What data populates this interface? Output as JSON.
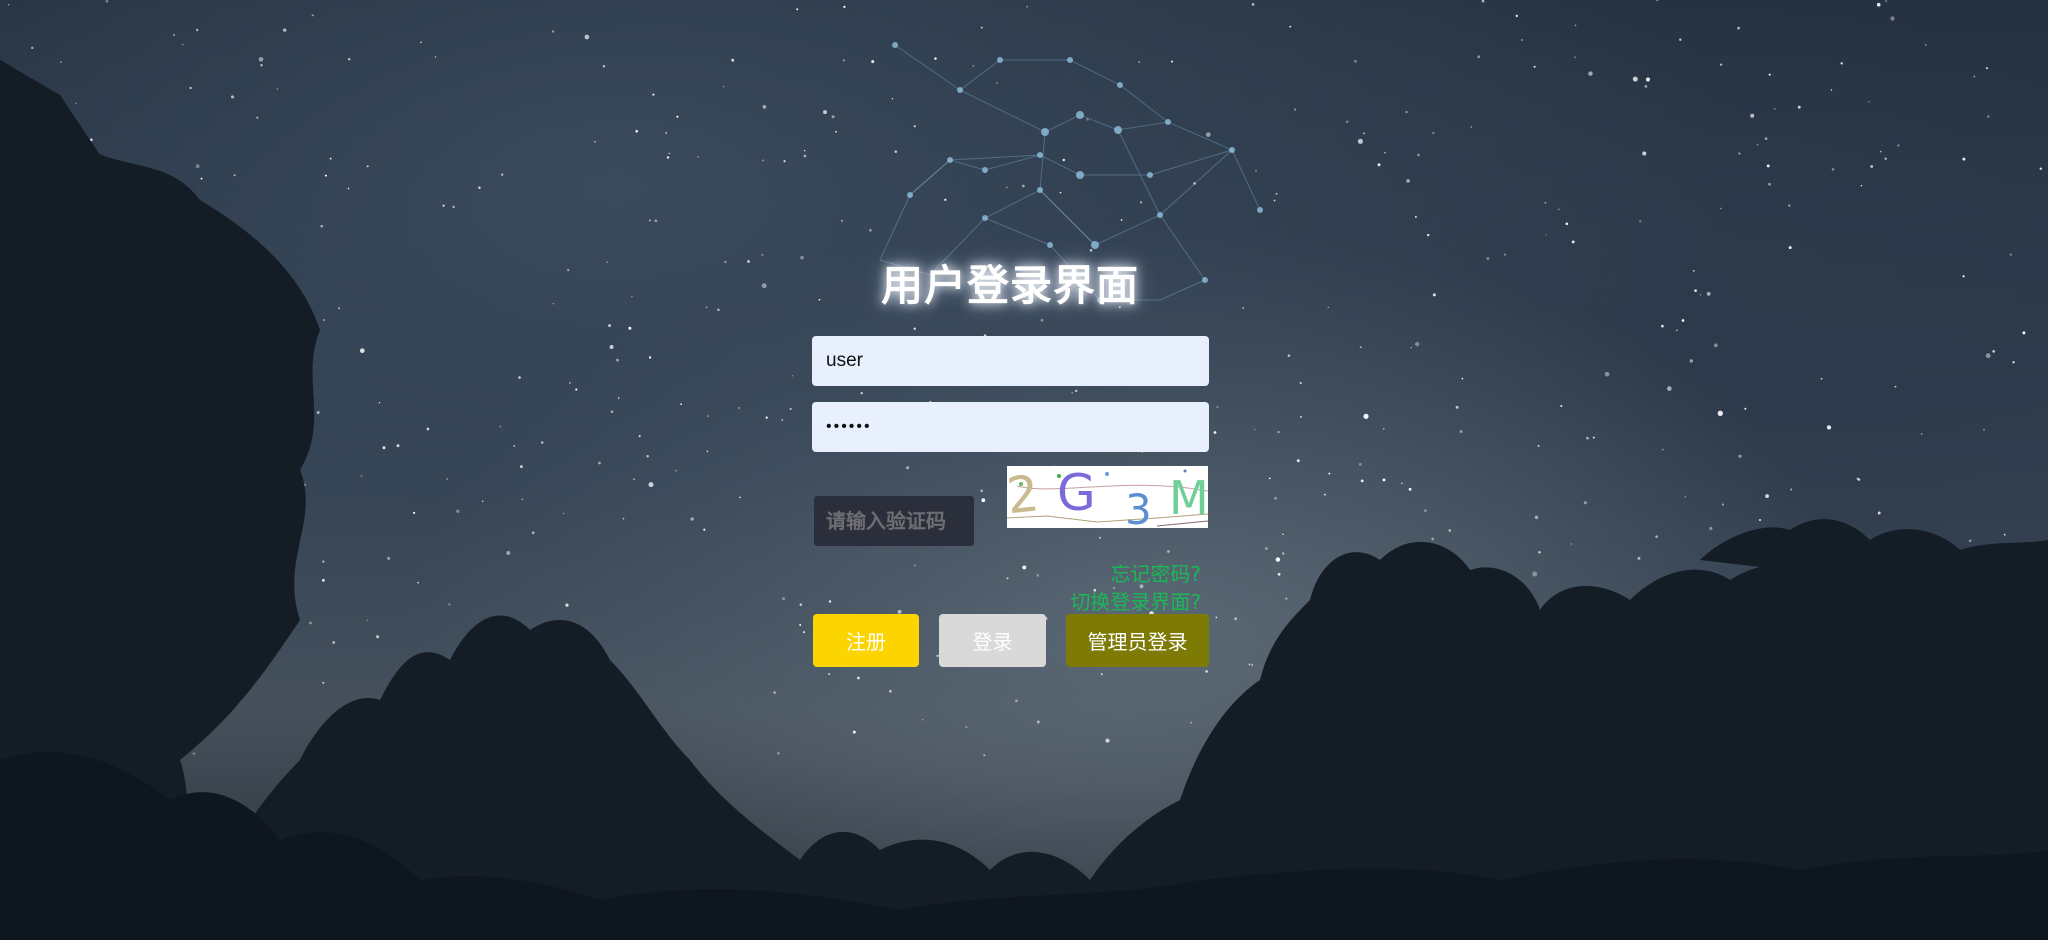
{
  "page": {
    "title": "用户登录界面"
  },
  "form": {
    "username_value": "user",
    "password_value": "••••••",
    "captcha_placeholder": "请输入验证码",
    "captcha_text": "2G3M"
  },
  "links": {
    "forgot_password": "忘记密码?",
    "switch_login": "切换登录界面?"
  },
  "buttons": {
    "register": "注册",
    "login": "登录",
    "admin_login": "管理员登录"
  },
  "colors": {
    "link": "#19b955",
    "register_button": "#fcd400",
    "login_button": "#d9d9d9",
    "admin_button": "#7d7b05",
    "input_background": "#e8f0fe"
  }
}
